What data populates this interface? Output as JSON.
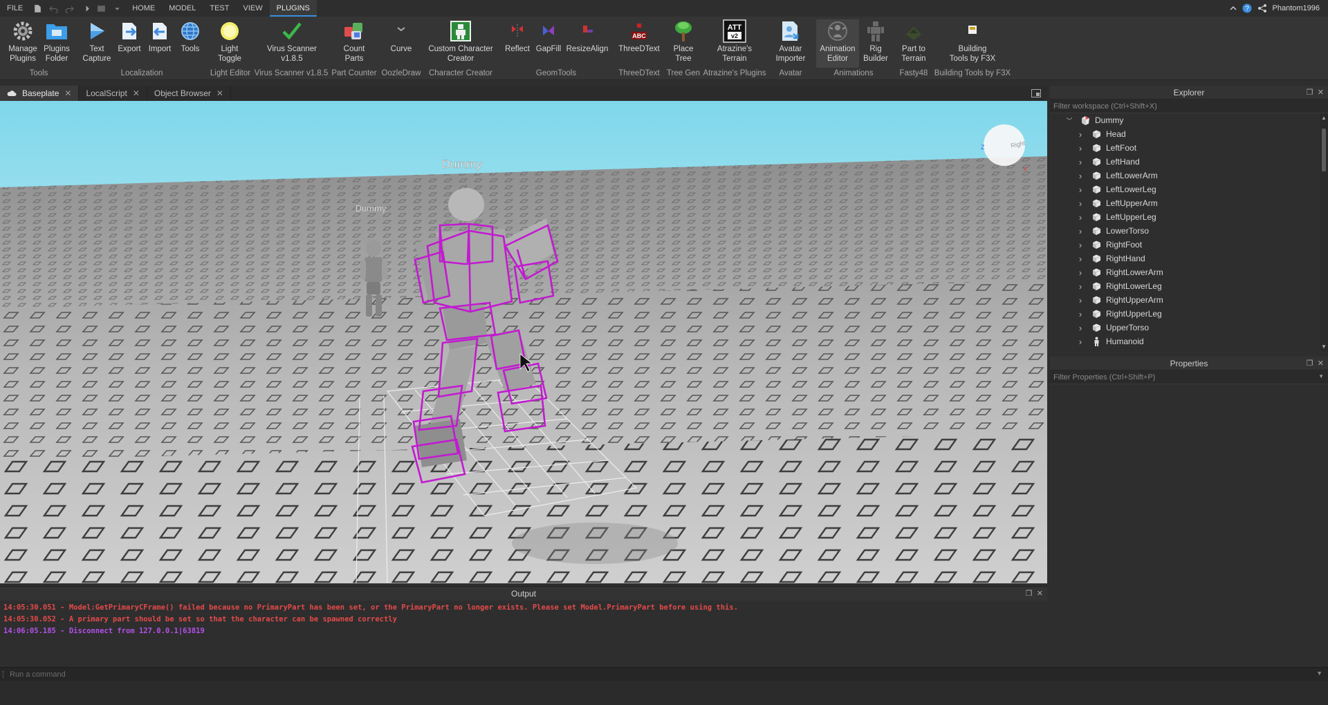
{
  "menubar": {
    "items": [
      "FILE",
      "HOME",
      "MODEL",
      "TEST",
      "VIEW",
      "PLUGINS"
    ],
    "active": "PLUGINS",
    "username": "Phantom1996"
  },
  "ribbon": {
    "buttons": [
      {
        "label": "Manage\nPlugins",
        "icon": "gear-icon"
      },
      {
        "label": "Plugins\nFolder",
        "icon": "folder-icon"
      },
      {
        "label": "Text\nCapture",
        "icon": "text-capture-icon"
      },
      {
        "label": "Export",
        "icon": "export-icon"
      },
      {
        "label": "Import",
        "icon": "import-icon"
      },
      {
        "label": "Tools",
        "icon": "globe-icon"
      },
      {
        "label": "Light\nToggle",
        "icon": "light-bulb-icon"
      },
      {
        "label": "Virus Scanner\nv1.8.5",
        "icon": "checkmark-icon"
      },
      {
        "label": "Count\nParts",
        "icon": "parts-icon"
      },
      {
        "label": "Curve",
        "icon": "curve-icon"
      },
      {
        "label": "Custom Character\nCreator",
        "icon": "character-creator-icon"
      },
      {
        "label": "Reflect",
        "icon": "reflect-icon"
      },
      {
        "label": "GapFill",
        "icon": "gapfill-icon"
      },
      {
        "label": "ResizeAlign",
        "icon": "resize-align-icon"
      },
      {
        "label": "ThreeDText",
        "icon": "three-d-text-icon"
      },
      {
        "label": "Place\nTree",
        "icon": "tree-icon"
      },
      {
        "label": "Atrazine's\nTerrain",
        "icon": "terrain-att-icon"
      },
      {
        "label": "Avatar\nImporter",
        "icon": "avatar-importer-icon"
      },
      {
        "label": "Animation\nEditor",
        "icon": "animation-editor-icon"
      },
      {
        "label": "Rig\nBuilder",
        "icon": "rig-builder-icon"
      },
      {
        "label": "Part to\nTerrain",
        "icon": "part-to-terrain-icon"
      },
      {
        "label": "Building\nTools by F3X",
        "icon": "building-tools-icon"
      }
    ],
    "groups": [
      "Tools",
      "Localization",
      "Light Editor",
      "Virus Scanner v1.8.5",
      "Part Counter",
      "OozleDraw",
      "Character Creator",
      "GeomTools",
      "ThreeDText",
      "Tree Gen",
      "Atrazine's Plugins",
      "Avatar",
      "Animations",
      "Fasty48",
      "Building Tools by F3X"
    ],
    "att_text": "ATT",
    "att_version": "v2",
    "abc_text": "ABC"
  },
  "tabs": [
    {
      "label": "Baseplate",
      "active": true
    },
    {
      "label": "LocalScript",
      "active": false
    },
    {
      "label": "Object Browser",
      "active": false
    }
  ],
  "viewport": {
    "label_near": "Dummy",
    "label_far": "Dummy",
    "axis_z": "Z",
    "axis_x": "X",
    "view_cube_face": "Right"
  },
  "output": {
    "title": "Output",
    "lines": [
      {
        "text": "14:05:30.051 - Model:GetPrimaryCFrame() failed because no PrimaryPart has been set, or the PrimaryPart no longer exists. Please set Model.PrimaryPart before using this.",
        "color": "#e44a4a"
      },
      {
        "text": "14:05:30.052 - A primary part should be set so that the character can be spawned correctly",
        "color": "#e44a4a"
      },
      {
        "text": "14:06:05.185 - Disconnect from 127.0.0.1|63819",
        "color": "#b451e8"
      }
    ]
  },
  "command": {
    "placeholder": "Run a command"
  },
  "explorer": {
    "title": "Explorer",
    "filter_placeholder": "Filter workspace (Ctrl+Shift+X)",
    "root": "Dummy",
    "children": [
      "Head",
      "LeftFoot",
      "LeftHand",
      "LeftLowerArm",
      "LeftLowerLeg",
      "LeftUpperArm",
      "LeftUpperLeg",
      "LowerTorso",
      "RightFoot",
      "RightHand",
      "RightLowerArm",
      "RightLowerLeg",
      "RightUpperArm",
      "RightUpperLeg",
      "UpperTorso",
      "Humanoid"
    ]
  },
  "properties": {
    "title": "Properties",
    "filter_placeholder": "Filter Properties (Ctrl+Shift+P)"
  },
  "colors": {
    "selection": "#c21ad0",
    "accent": "#3a8fe0",
    "error": "#e44a4a",
    "info": "#b451e8"
  }
}
